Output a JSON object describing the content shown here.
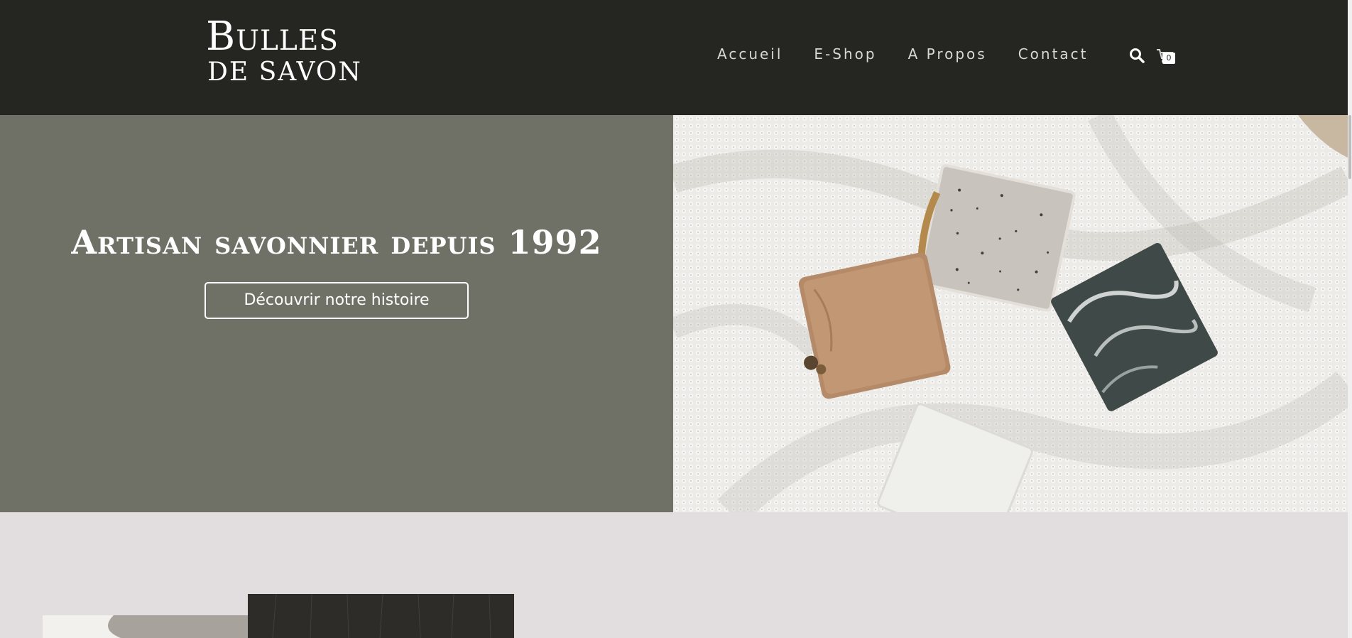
{
  "logo": {
    "line1": "Bulles",
    "line2": "DE SAVON"
  },
  "nav": {
    "items": [
      {
        "label": "Accueil"
      },
      {
        "label": "E-Shop"
      },
      {
        "label": "A Propos"
      },
      {
        "label": "Contact"
      }
    ],
    "search_icon": "search-icon",
    "cart_icon": "cart-icon",
    "cart_count": "0"
  },
  "hero": {
    "title": "Artisan savonnier depuis 1992",
    "button_label": "Découvrir notre histoire"
  },
  "colors": {
    "header_bg": "#252521",
    "hero_left_bg": "#707166",
    "page_bg": "#e2dedf",
    "text_light": "#ffffff"
  }
}
